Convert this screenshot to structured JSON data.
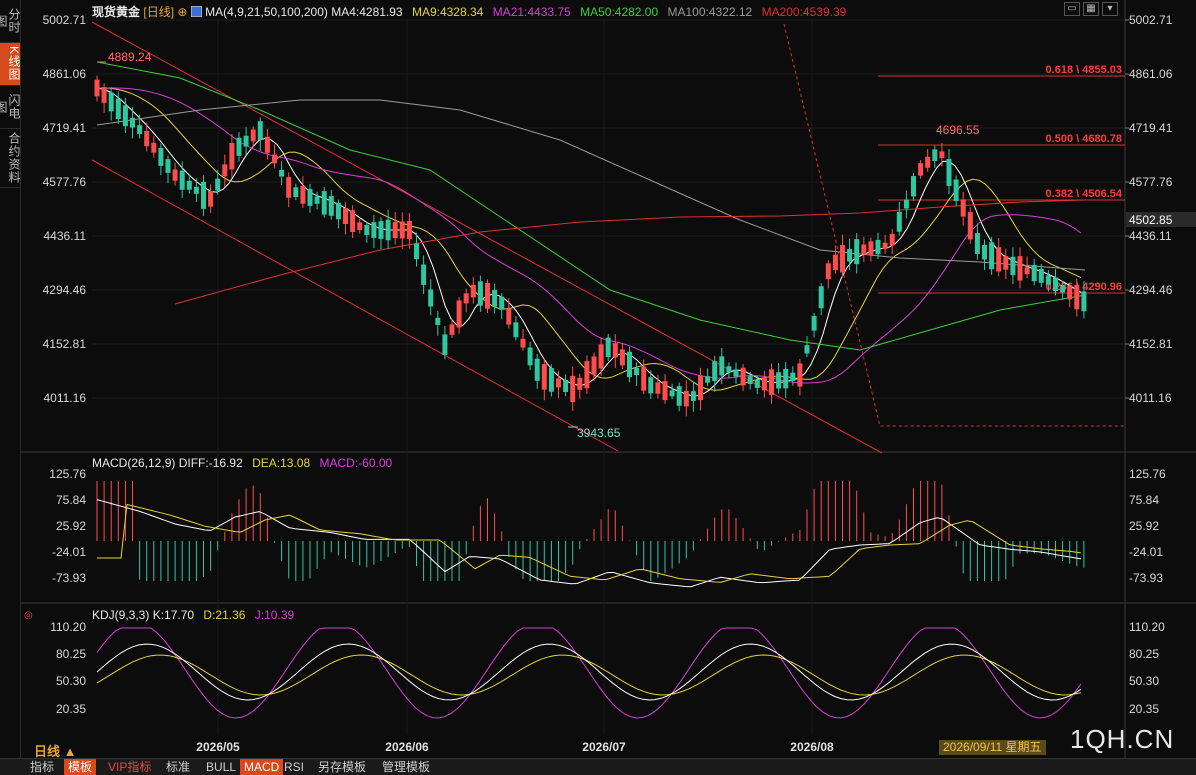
{
  "sidebar": {
    "tabs": [
      {
        "label": "分时图",
        "active": false
      },
      {
        "label": "K线图",
        "active": true
      },
      {
        "label": "闪电图",
        "active": false
      },
      {
        "label": "合约资料",
        "active": false
      }
    ]
  },
  "header": {
    "instrument": "现货黄金",
    "period_tag": "[日线]",
    "ma_label": "MA(4,9,21,50,100,200)",
    "ma4": "MA4:4281.93",
    "ma9": "MA9:4328.34",
    "ma21": "MA21:4433.75",
    "ma50": "MA50:4282.00",
    "ma100": "MA100:4322.12",
    "ma200": "MA200:4539.39"
  },
  "price_axis": [
    "5002.71",
    "4861.06",
    "4719.41",
    "4577.76",
    "4436.11",
    "4294.46",
    "4152.81",
    "4011.16"
  ],
  "current_price": "4502.85",
  "annotations": {
    "high_left": "4889.24",
    "low": "3943.65",
    "high_right": "4696.55"
  },
  "fib": [
    {
      "label": "0.618 \\ 4855.03"
    },
    {
      "label": "0.500 \\ 4680.78"
    },
    {
      "label": "0.382 \\ 4506.54"
    },
    {
      "label": "0.236 \\ 4290.96"
    }
  ],
  "macd": {
    "label": "MACD(26,12,9)",
    "diff": "DIFF:-16.92",
    "dea": "DEA:13.08",
    "macd": "MACD:-60.00",
    "axis": [
      "125.76",
      "75.84",
      "25.92",
      "-24.01",
      "-73.93"
    ]
  },
  "kdj": {
    "label": "KDJ(9,3,3)",
    "k": "K:17.70",
    "d": "D:21.36",
    "j": "J:10.39",
    "axis": [
      "110.20",
      "80.25",
      "50.30",
      "20.35"
    ]
  },
  "time_axis": [
    "2026/05",
    "2026/06",
    "2026/07",
    "2026/08"
  ],
  "date_label": "2026/09/11 星期五",
  "period_selector": "日线 ▲",
  "watermark": "1QH.CN",
  "bottom_tabs": [
    "指标",
    "模板",
    "VIP指标",
    "标准",
    "BULL",
    "MACD",
    "RSI",
    "另存模板",
    "管理模板"
  ],
  "colors": {
    "up": "#ff4d4d",
    "down": "#2fc7a0",
    "ma4": "#ffffff",
    "ma9": "#e6d23a",
    "ma21": "#d63fd6",
    "ma50": "#3fcf3f",
    "ma100": "#9a9a9a",
    "ma200": "#e03030"
  }
}
